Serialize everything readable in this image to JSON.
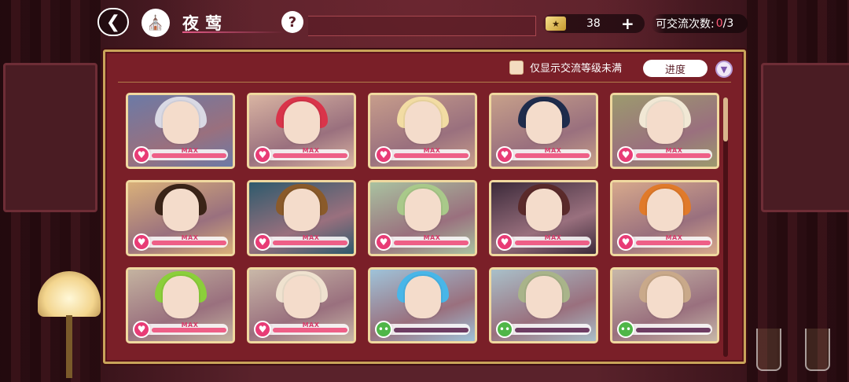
{
  "header": {
    "title": "夜莺",
    "help_label": "?",
    "currency": {
      "icon": "ticket-icon",
      "amount": "38",
      "plus_label": "+"
    },
    "exchange": {
      "label": "可交流次数:",
      "current": "0",
      "total": "/3"
    }
  },
  "filter": {
    "checkbox_label": "仅显示交流等级未满",
    "checked": false,
    "sort_label": "进度"
  },
  "colors": {
    "panel": "#7a1f28",
    "frame_gold": "#c9a45a",
    "heart_pink": "#e83c76",
    "heart_green": "#4fb648",
    "bar_fill": "#ee5f87"
  },
  "cards": [
    {
      "max_label": "MAX",
      "mood": "love",
      "progress": 1.0,
      "bg": "#6c7aa6",
      "hair": "#d9d9e4"
    },
    {
      "max_label": "MAX",
      "mood": "love",
      "progress": 1.0,
      "bg": "#d9b4a2",
      "hair": "#d9344a"
    },
    {
      "max_label": "MAX",
      "mood": "love",
      "progress": 1.0,
      "bg": "#c79d8b",
      "hair": "#f2dca3"
    },
    {
      "max_label": "MAX",
      "mood": "love",
      "progress": 1.0,
      "bg": "#c7a08a",
      "hair": "#1f2c4c"
    },
    {
      "max_label": "MAX",
      "mood": "love",
      "progress": 1.0,
      "bg": "#9c9a6e",
      "hair": "#f1e8d5"
    },
    {
      "max_label": "MAX",
      "mood": "love",
      "progress": 1.0,
      "bg": "#d9b07a",
      "hair": "#3a2418"
    },
    {
      "max_label": "MAX",
      "mood": "love",
      "progress": 1.0,
      "bg": "#2e5a6c",
      "hair": "#8a5a2a"
    },
    {
      "max_label": "MAX",
      "mood": "love",
      "progress": 1.0,
      "bg": "#a9c2a0",
      "hair": "#a9c98a"
    },
    {
      "max_label": "MAX",
      "mood": "love",
      "progress": 1.0,
      "bg": "#3c2a3a",
      "hair": "#5a2a2a"
    },
    {
      "max_label": "MAX",
      "mood": "love",
      "progress": 1.0,
      "bg": "#d7a98c",
      "hair": "#e07a2a"
    },
    {
      "max_label": "MAX",
      "mood": "love",
      "progress": 1.0,
      "bg": "#c4b3a0",
      "hair": "#8bcf3a"
    },
    {
      "max_label": "MAX",
      "mood": "love",
      "progress": 1.0,
      "bg": "#c9b8a8",
      "hair": "#efe2cf"
    },
    {
      "max_label": "",
      "mood": "neutral",
      "progress": 0.0,
      "bg": "#9fc3d9",
      "hair": "#48b6e8"
    },
    {
      "max_label": "",
      "mood": "neutral",
      "progress": 0.0,
      "bg": "#a9c0c9",
      "hair": "#a9b48a"
    },
    {
      "max_label": "",
      "mood": "neutral",
      "progress": 0.0,
      "bg": "#c7b8a9",
      "hair": "#c9a98a"
    }
  ]
}
